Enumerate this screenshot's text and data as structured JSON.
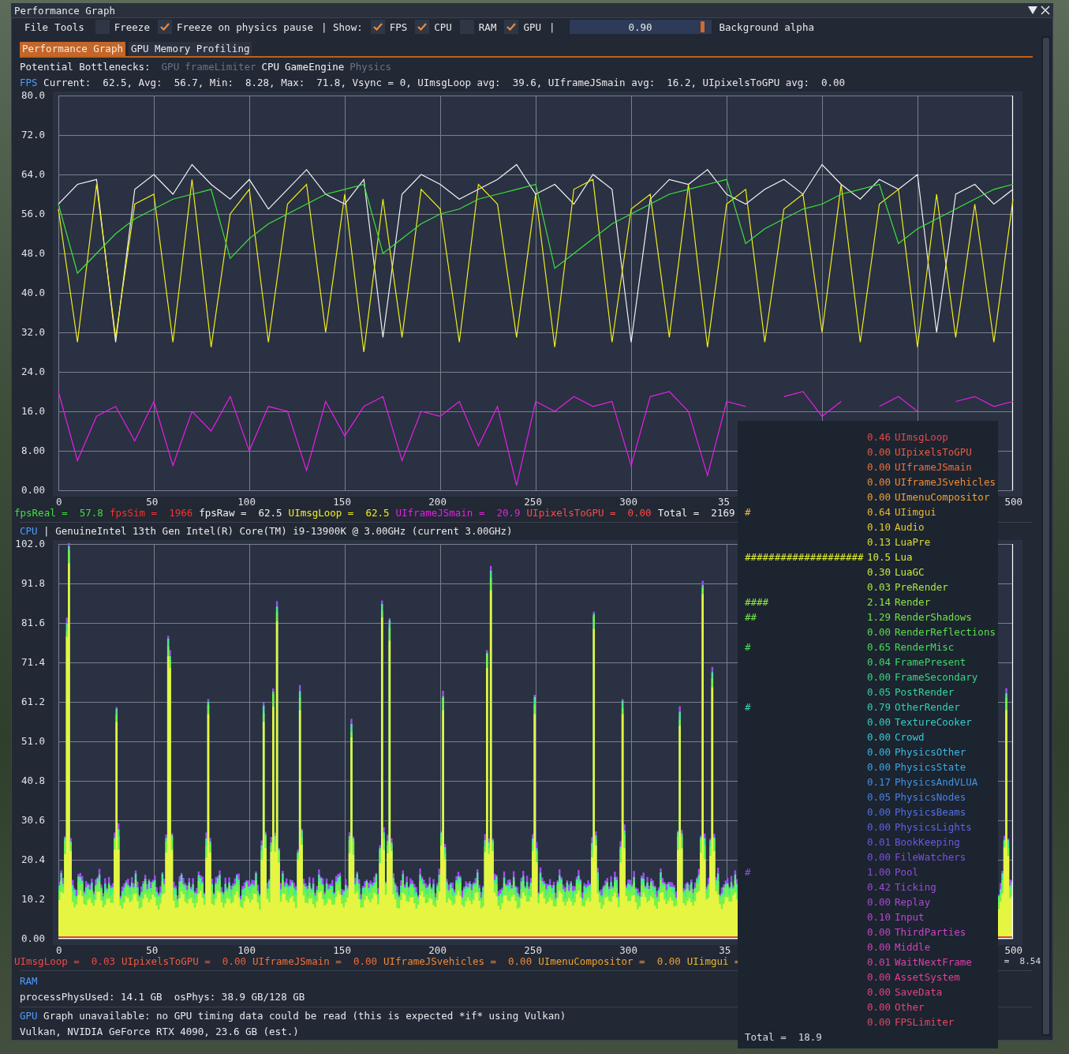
{
  "window": {
    "title": "Performance Graph"
  },
  "toolbar": [
    {
      "kind": "menu",
      "label": "File"
    },
    {
      "kind": "menu",
      "label": "Tools"
    },
    {
      "kind": "checkbox",
      "label": "Freeze",
      "checked": false
    },
    {
      "kind": "checkbox",
      "label": "Freeze on physics pause",
      "checked": true
    },
    {
      "kind": "text",
      "label": "| Show:"
    },
    {
      "kind": "checkbox",
      "label": "FPS",
      "checked": true
    },
    {
      "kind": "checkbox",
      "label": "CPU",
      "checked": true
    },
    {
      "kind": "checkbox",
      "label": "RAM",
      "checked": false
    },
    {
      "kind": "checkbox",
      "label": "GPU",
      "checked": true
    },
    {
      "kind": "text",
      "label": "|"
    },
    {
      "kind": "slider",
      "value": "0.90",
      "level": 0.9
    },
    {
      "kind": "text",
      "label": "Background alpha"
    }
  ],
  "tabs": [
    {
      "label": "Performance Graph",
      "selected": true
    },
    {
      "label": "GPU Memory Profiling",
      "selected": false
    }
  ],
  "bottlenecks": {
    "label": "Potential Bottlenecks:",
    "items": [
      {
        "label": "GPU",
        "active": false
      },
      {
        "label": "frameLimiter",
        "active": false
      },
      {
        "label": "CPU",
        "active": true
      },
      {
        "label": "GameEngine",
        "active": true
      },
      {
        "label": "Physics",
        "active": false
      }
    ]
  },
  "fps": {
    "heading": "FPS",
    "stats": "Current:  62.5, Avg:  56.7, Min:  8.28, Max:  71.8, Vsync = 0, UImsgLoop avg:  39.6, UIframeJSmain avg:  16.2, UIpixelsToGPU avg:  0.00",
    "chart_data": {
      "type": "line",
      "grid": true,
      "xlim": [
        0,
        500
      ],
      "ylim": [
        0,
        80
      ],
      "x": [
        0,
        10,
        20,
        30,
        40,
        50,
        60,
        70,
        80,
        90,
        100,
        110,
        120,
        130,
        140,
        150,
        160,
        170,
        180,
        190,
        200,
        210,
        220,
        230,
        240,
        250,
        260,
        270,
        280,
        290,
        300,
        310,
        320,
        330,
        340,
        350,
        360,
        370,
        380,
        390,
        400,
        410,
        420,
        430,
        440,
        450,
        460,
        470,
        480,
        490,
        500
      ],
      "xticks": [
        0,
        50,
        100,
        150,
        200,
        250,
        300,
        500
      ],
      "yticks": [
        {
          "value": 80,
          "label": "80.0"
        },
        {
          "value": 72,
          "label": "72.0"
        },
        {
          "value": 64,
          "label": "64.0"
        },
        {
          "value": 56,
          "label": "56.0"
        },
        {
          "value": 48,
          "label": "48.0"
        },
        {
          "value": 40,
          "label": "40.0"
        },
        {
          "value": 32,
          "label": "32.0"
        },
        {
          "value": 24,
          "label": "24.0"
        },
        {
          "value": 16,
          "label": "16.0"
        },
        {
          "value": 8,
          "label": "8.00"
        },
        {
          "value": 0,
          "label": "0.00"
        }
      ],
      "series": [
        {
          "color": "#f2f2f2",
          "values": [
            58,
            62,
            63,
            30,
            61,
            64,
            60,
            66,
            62,
            59,
            63,
            57,
            61,
            65,
            60,
            58,
            63,
            31,
            60,
            64,
            62,
            59,
            61,
            63,
            66,
            60,
            62,
            58,
            64,
            61,
            30,
            59,
            63,
            62,
            65,
            60,
            58,
            61,
            63,
            60,
            66,
            62,
            59,
            63,
            61,
            64,
            32,
            60,
            62,
            58,
            61
          ]
        },
        {
          "color": "#f2ee1c",
          "values": [
            57,
            30,
            62,
            31,
            58,
            60,
            30,
            63,
            29,
            56,
            61,
            30,
            58,
            62,
            32,
            60,
            28,
            59,
            31,
            61,
            57,
            30,
            62,
            58,
            31,
            60,
            29,
            61,
            63,
            30,
            57,
            60,
            31,
            62,
            29,
            58,
            61,
            30,
            57,
            60,
            32,
            62,
            30,
            58,
            61,
            29,
            60,
            31,
            58,
            30,
            59
          ]
        },
        {
          "color": "#3ee03e",
          "values": [
            58,
            44,
            48,
            52,
            55,
            57,
            59,
            60,
            61,
            47,
            51,
            54,
            56,
            58,
            60,
            61,
            62,
            48,
            51,
            54,
            56,
            57,
            59,
            60,
            61,
            62,
            45,
            48,
            51,
            54,
            56,
            58,
            60,
            61,
            62,
            63,
            50,
            53,
            55,
            57,
            58,
            60,
            61,
            62,
            50,
            53,
            55,
            57,
            59,
            61,
            62
          ]
        },
        {
          "color": "#e81ee8",
          "values": [
            20,
            6,
            15,
            17,
            10,
            18,
            5,
            16,
            12,
            19,
            8,
            17,
            16,
            4,
            18,
            11,
            17,
            19,
            6,
            16,
            15,
            18,
            9,
            17,
            1,
            18,
            16,
            19,
            17,
            18,
            5,
            19,
            20,
            16,
            3,
            18,
            17,
            null,
            19,
            20,
            15,
            18,
            null,
            17,
            19,
            16,
            null,
            18,
            19,
            17,
            18
          ]
        }
      ]
    },
    "clipped_tick_label": "35",
    "legend": [
      {
        "text": "fpsReal =  57.8",
        "color": "#3ee03e"
      },
      {
        "text": "fpsSim =  1966",
        "color": "#ff2e2e"
      },
      {
        "text": "fpsRaw =  62.5",
        "color": "#f2f2f2"
      },
      {
        "text": "UImsgLoop =  62.5",
        "color": "#f2ee1c"
      },
      {
        "text": "UIframeJSmain =  20.9",
        "color": "#e81ee8"
      },
      {
        "text": "UIpixelsToGPU =  0.00",
        "color": "#ff4a4a"
      },
      {
        "text": "Total =  2169",
        "color": "#f2f2f2"
      }
    ]
  },
  "cpu": {
    "heading": "CPU",
    "info": "| GenuineIntel 13th Gen Intel(R) Core(TM) i9-13900K @ 3.00GHz (current 3.00GHz)",
    "y_ticks": [
      "102.0",
      "91.8",
      "81.6",
      "71.4",
      "61.2",
      "51.0",
      "40.8",
      "30.6",
      "20.4",
      "10.2",
      "0.00"
    ],
    "x_ticks": [
      "0",
      "50",
      "100",
      "150",
      "200",
      "250",
      "300",
      "35",
      "500"
    ],
    "legend": [
      {
        "text": "UImsgLoop =  0.03",
        "color": "#ee4a4a"
      },
      {
        "text": "UIpixelsToGPU =  0.00",
        "color": "#ef5c40"
      },
      {
        "text": "UIframeJSmain =  0.00",
        "color": "#f0703a"
      },
      {
        "text": "UIframeJSvehicles =  0.00",
        "color": "#f08836"
      },
      {
        "text": "UImenuCompositor =  0.00",
        "color": "#eea232"
      },
      {
        "text": "UIimgui =",
        "color": "#e8b830"
      }
    ],
    "legend_tail": {
      "text": "=  8.54",
      "color": "#d8dce4"
    }
  },
  "ram": {
    "heading": "RAM",
    "info": "processPhysUsed: 14.1 GB  osPhys: 38.9 GB/128 GB"
  },
  "gpu": {
    "heading": "GPU",
    "info": "Graph unavailable: no GPU timing data could be read (this is expected *if* using Vulkan)",
    "device": "Vulkan, NVIDIA GeForce RTX 4090, 23.6 GB (est.)"
  },
  "tooltip": {
    "rows": [
      {
        "bar": "",
        "value": "0.46",
        "name": "UImsgLoop",
        "color": "#e8474a"
      },
      {
        "bar": "",
        "value": "0.00",
        "name": "UIpixelsToGPU",
        "color": "#ec5a3f"
      },
      {
        "bar": "",
        "value": "0.00",
        "name": "UIframeJSmain",
        "color": "#ee6e3a"
      },
      {
        "bar": "",
        "value": "0.00",
        "name": "UIframeJSvehicles",
        "color": "#ef8a36"
      },
      {
        "bar": "",
        "value": "0.00",
        "name": "UImenuCompositor",
        "color": "#eea232"
      },
      {
        "bar": "#",
        "value": "0.64",
        "name": "UIimgui",
        "color": "#e8b830"
      },
      {
        "bar": "",
        "value": "0.10",
        "name": "Audio",
        "color": "#e4cc30"
      },
      {
        "bar": "",
        "value": "0.13",
        "name": "LuaPre",
        "color": "#dede30"
      },
      {
        "bar": "####################",
        "value": "10.5",
        "name": "Lua",
        "color": "#d8ea35"
      },
      {
        "bar": "",
        "value": "0.30",
        "name": "LuaGC",
        "color": "#c4ec38"
      },
      {
        "bar": "",
        "value": "0.03",
        "name": "PreRender",
        "color": "#a8ea3c"
      },
      {
        "bar": "####",
        "value": "2.14",
        "name": "Render",
        "color": "#8ce640"
      },
      {
        "bar": "##",
        "value": "1.29",
        "name": "RenderShadows",
        "color": "#70e244"
      },
      {
        "bar": "",
        "value": "0.00",
        "name": "RenderReflections",
        "color": "#5ade4a"
      },
      {
        "bar": "#",
        "value": "0.65",
        "name": "RenderMisc",
        "color": "#4ada56"
      },
      {
        "bar": "",
        "value": "0.04",
        "name": "FramePresent",
        "color": "#40d66a"
      },
      {
        "bar": "",
        "value": "0.00",
        "name": "FrameSecondary",
        "color": "#3ad480"
      },
      {
        "bar": "",
        "value": "0.05",
        "name": "PostRender",
        "color": "#36d298"
      },
      {
        "bar": "#",
        "value": "0.79",
        "name": "OtherRender",
        "color": "#34d0ae"
      },
      {
        "bar": "",
        "value": "0.00",
        "name": "TextureCooker",
        "color": "#34cec4"
      },
      {
        "bar": "",
        "value": "0.00",
        "name": "Crowd",
        "color": "#36c8d6"
      },
      {
        "bar": "",
        "value": "0.00",
        "name": "PhysicsOther",
        "color": "#38b8dc"
      },
      {
        "bar": "",
        "value": "0.00",
        "name": "PhysicsState",
        "color": "#3ca6e0"
      },
      {
        "bar": "",
        "value": "0.17",
        "name": "PhysicsAndVLUA",
        "color": "#4292e2"
      },
      {
        "bar": "",
        "value": "0.05",
        "name": "PhysicsNodes",
        "color": "#4a80e4"
      },
      {
        "bar": "",
        "value": "0.00",
        "name": "PhysicsBeams",
        "color": "#546ee4"
      },
      {
        "bar": "",
        "value": "0.00",
        "name": "PhysicsLights",
        "color": "#6060e2"
      },
      {
        "bar": "",
        "value": "0.01",
        "name": "BookKeeping",
        "color": "#6c56e0"
      },
      {
        "bar": "",
        "value": "0.00",
        "name": "FileWatchers",
        "color": "#7a50dc"
      },
      {
        "bar": "#",
        "value": "1.00",
        "name": "Pool",
        "color": "#8a4ed8"
      },
      {
        "bar": "",
        "value": "0.42",
        "name": "Ticking",
        "color": "#9a4cd4"
      },
      {
        "bar": "",
        "value": "0.00",
        "name": "Replay",
        "color": "#aa4ad0"
      },
      {
        "bar": "",
        "value": "0.10",
        "name": "Input",
        "color": "#b848cc"
      },
      {
        "bar": "",
        "value": "0.00",
        "name": "ThirdParties",
        "color": "#c446c6"
      },
      {
        "bar": "",
        "value": "0.00",
        "name": "Middle",
        "color": "#ce44b8"
      },
      {
        "bar": "",
        "value": "0.01",
        "name": "WaitNextFrame",
        "color": "#d642a8"
      },
      {
        "bar": "",
        "value": "0.00",
        "name": "AssetSystem",
        "color": "#dc4296"
      },
      {
        "bar": "",
        "value": "0.00",
        "name": "SaveData",
        "color": "#e04284"
      },
      {
        "bar": "",
        "value": "0.00",
        "name": "Other",
        "color": "#e24474"
      },
      {
        "bar": "",
        "value": "0.00",
        "name": "FPSLimiter",
        "color": "#e44664"
      }
    ],
    "total": "Total =  18.9"
  }
}
